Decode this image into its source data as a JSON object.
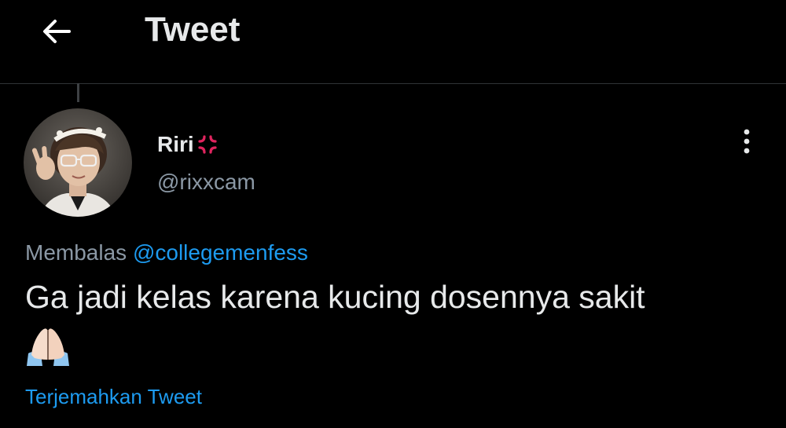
{
  "header": {
    "title": "Tweet",
    "back_icon": "arrow-left-icon"
  },
  "author": {
    "display_name": "Riri",
    "name_emoji_icon": "anger-symbol-icon",
    "handle": "@rixxcam",
    "avatar_icon": "profile-photo"
  },
  "more_icon": "vertical-ellipsis-icon",
  "reply": {
    "prefix": "Membalas",
    "mention": "@collegemenfess"
  },
  "tweet": {
    "text": "Ga jadi kelas karena kucing dosennya sakit",
    "emoji_icon": "folded-hands-icon"
  },
  "translate_label": "Terjemahkan Tweet",
  "colors": {
    "background": "#000000",
    "text": "#e7e9ea",
    "secondary_text": "#8b98a5",
    "accent": "#1d9bf0",
    "divider": "#2f3336",
    "anger_red": "#e0245e"
  }
}
